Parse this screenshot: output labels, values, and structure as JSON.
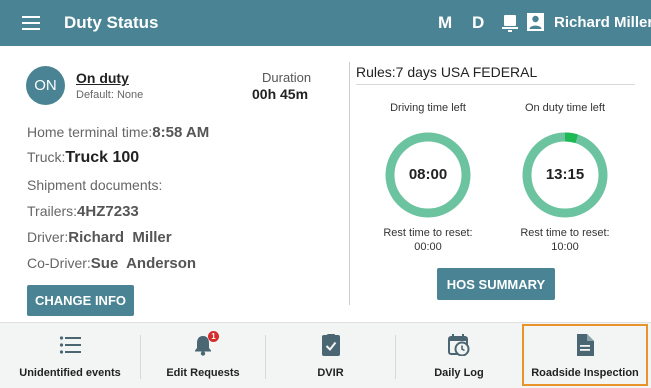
{
  "header": {
    "title": "Duty Status",
    "mode_m": "M",
    "mode_d": "D",
    "user_name": "Richard Miller",
    "bg_color": "#4a8494"
  },
  "status": {
    "badge": "ON",
    "label": "On duty",
    "default": "Default: None",
    "duration_label": "Duration",
    "duration_value": "00h 45m"
  },
  "info": {
    "home_terminal_label": "Home terminal time:",
    "home_terminal_value": "8:58 AM",
    "truck_label": "Truck:",
    "truck_value": "Truck 100",
    "shipment_label": "Shipment documents:",
    "trailers_label": "Trailers:",
    "trailers_value": "4HZ7233",
    "driver_label": "Driver:",
    "driver_value": "Richard  Miller",
    "codriver_label": "Co-Driver:",
    "codriver_value": "Sue  Anderson"
  },
  "buttons": {
    "change_info": "CHANGE INFO",
    "hos_summary": "HOS SUMMARY"
  },
  "rules": {
    "text": "Rules:7 days USA FEDERAL"
  },
  "gauges": {
    "driving": {
      "label": "Driving time left",
      "value": "08:00",
      "used_fraction": 0,
      "reset_label": "Rest time to reset:",
      "reset_value": "00:00"
    },
    "onduty": {
      "label": "On duty time left",
      "value": "13:15",
      "used_fraction": 0.05,
      "reset_label": "Rest time to reset:",
      "reset_value": "10:00"
    },
    "ring_color": "#6cc3a0",
    "used_color": "#1db954"
  },
  "nav": {
    "unidentified": "Unidentified events",
    "edit_requests": "Edit Requests",
    "edit_requests_badge": "1",
    "dvir": "DVIR",
    "daily_log": "Daily Log",
    "roadside": "Roadside Inspection",
    "highlight_color": "#e8942a"
  },
  "icons": {
    "menu": "hamburger-menu-icon",
    "device": "tablet-icon",
    "user": "user-icon",
    "list": "list-icon",
    "bell": "bell-icon",
    "dvir": "clipboard-check-icon",
    "daily_log": "calendar-clock-icon",
    "roadside": "document-icon"
  }
}
